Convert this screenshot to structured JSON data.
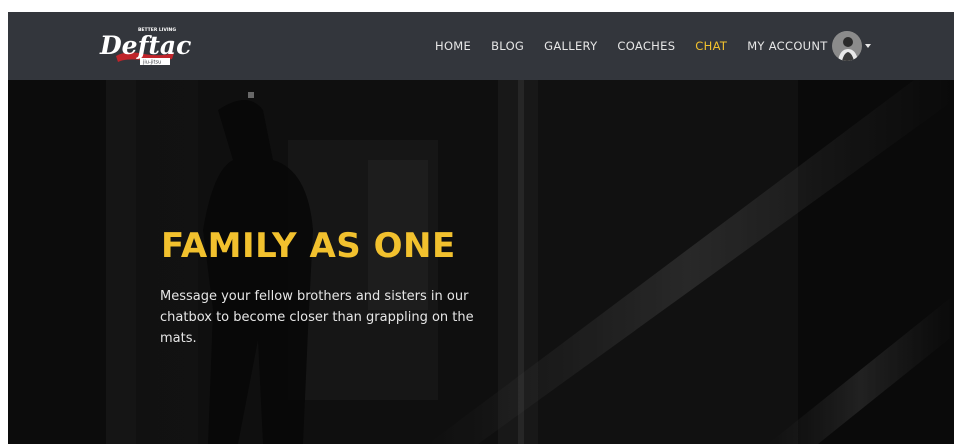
{
  "brand": {
    "name": "Deftac",
    "tagline": "BETTER LIVING",
    "subtitle": "jiu-jitsu"
  },
  "nav": {
    "items": [
      {
        "label": "HOME",
        "active": false
      },
      {
        "label": "BLOG",
        "active": false
      },
      {
        "label": "GALLERY",
        "active": false
      },
      {
        "label": "COACHES",
        "active": false
      },
      {
        "label": "CHAT",
        "active": true
      }
    ],
    "account_label": "MY ACCOUNT"
  },
  "hero": {
    "title": "FAMILY AS ONE",
    "text": "Message your fellow brothers and sisters in our chatbox to become closer than grappling on the mats."
  },
  "colors": {
    "nav_bg": "#33363c",
    "accent": "#f2c12e",
    "hero_bg": "#121212",
    "nav_text": "#e7e7e7"
  }
}
